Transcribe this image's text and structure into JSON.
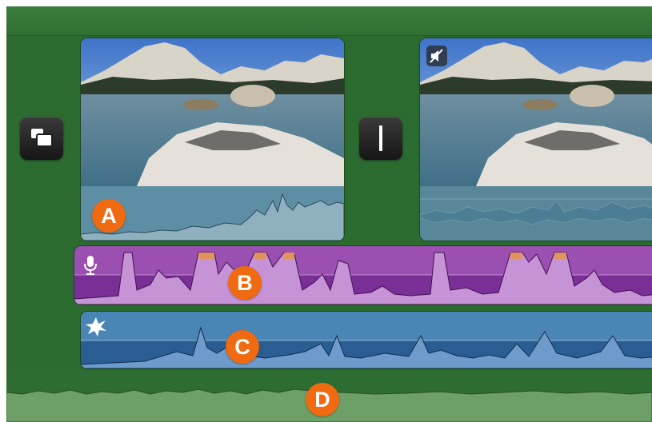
{
  "badges": {
    "clip_audio": "A",
    "voiceover": "B",
    "sound_effect": "C",
    "background_music": "D"
  },
  "colors": {
    "timeline_background": "#2b6b2f",
    "voiceover_track": "#9b4fb0",
    "sound_effect_track": "#4a86b5",
    "clip_audio": "#5e8ea3",
    "background_music": "#6da067",
    "badge": "#ef6a10"
  },
  "icons": {
    "cutaway_button": "picture-in-picture-icon",
    "transition_button": "vertical-bar-icon",
    "muted_clip": "speaker-muted-icon",
    "voiceover_track": "microphone-icon",
    "sound_effect_track": "burst-icon"
  },
  "clips": [
    {
      "name": "video-clip-1",
      "audio_muted": false
    },
    {
      "name": "video-clip-2",
      "audio_muted": true
    }
  ]
}
